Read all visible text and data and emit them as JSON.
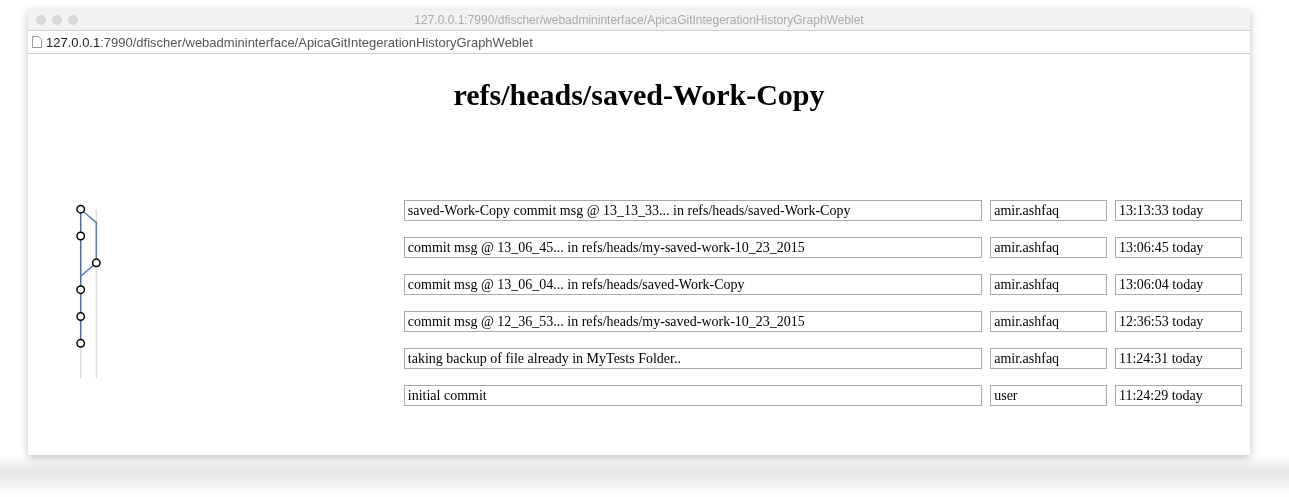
{
  "window": {
    "title": "127.0.0.1:7990/dfischer/webadmininterface/ApicaGitIntegerationHistoryGraphWeblet"
  },
  "address_bar": {
    "host": "127.0.0.1",
    "path": ":7990/dfischer/webadmininterface/ApicaGitIntegerationHistoryGraphWeblet"
  },
  "heading": "refs/heads/saved-Work-Copy",
  "commits": [
    {
      "kind": "main",
      "message": "saved-Work-Copy  commit msg @ 13_13_33... in refs/heads/saved-Work-Copy",
      "author": "amir.ashfaq",
      "time": "13:13:33 today"
    },
    {
      "kind": "main",
      "message": "commit msg @ 13_06_45... in refs/heads/my-saved-work-10_23_2015",
      "author": "amir.ashfaq",
      "time": "13:06:45 today"
    },
    {
      "kind": "branch",
      "message": "commit msg @ 13_06_04... in refs/heads/saved-Work-Copy",
      "author": "amir.ashfaq",
      "time": "13:06:04 today"
    },
    {
      "kind": "main",
      "message": "commit msg @ 12_36_53... in refs/heads/my-saved-work-10_23_2015",
      "author": "amir.ashfaq",
      "time": "12:36:53 today"
    },
    {
      "kind": "main",
      "message": "taking backup of file already in MyTests Folder..",
      "author": "amir.ashfaq",
      "time": "11:24:31 today"
    },
    {
      "kind": "main",
      "message": "initial commit",
      "author": "user",
      "time": "11:24:29 today"
    }
  ]
}
